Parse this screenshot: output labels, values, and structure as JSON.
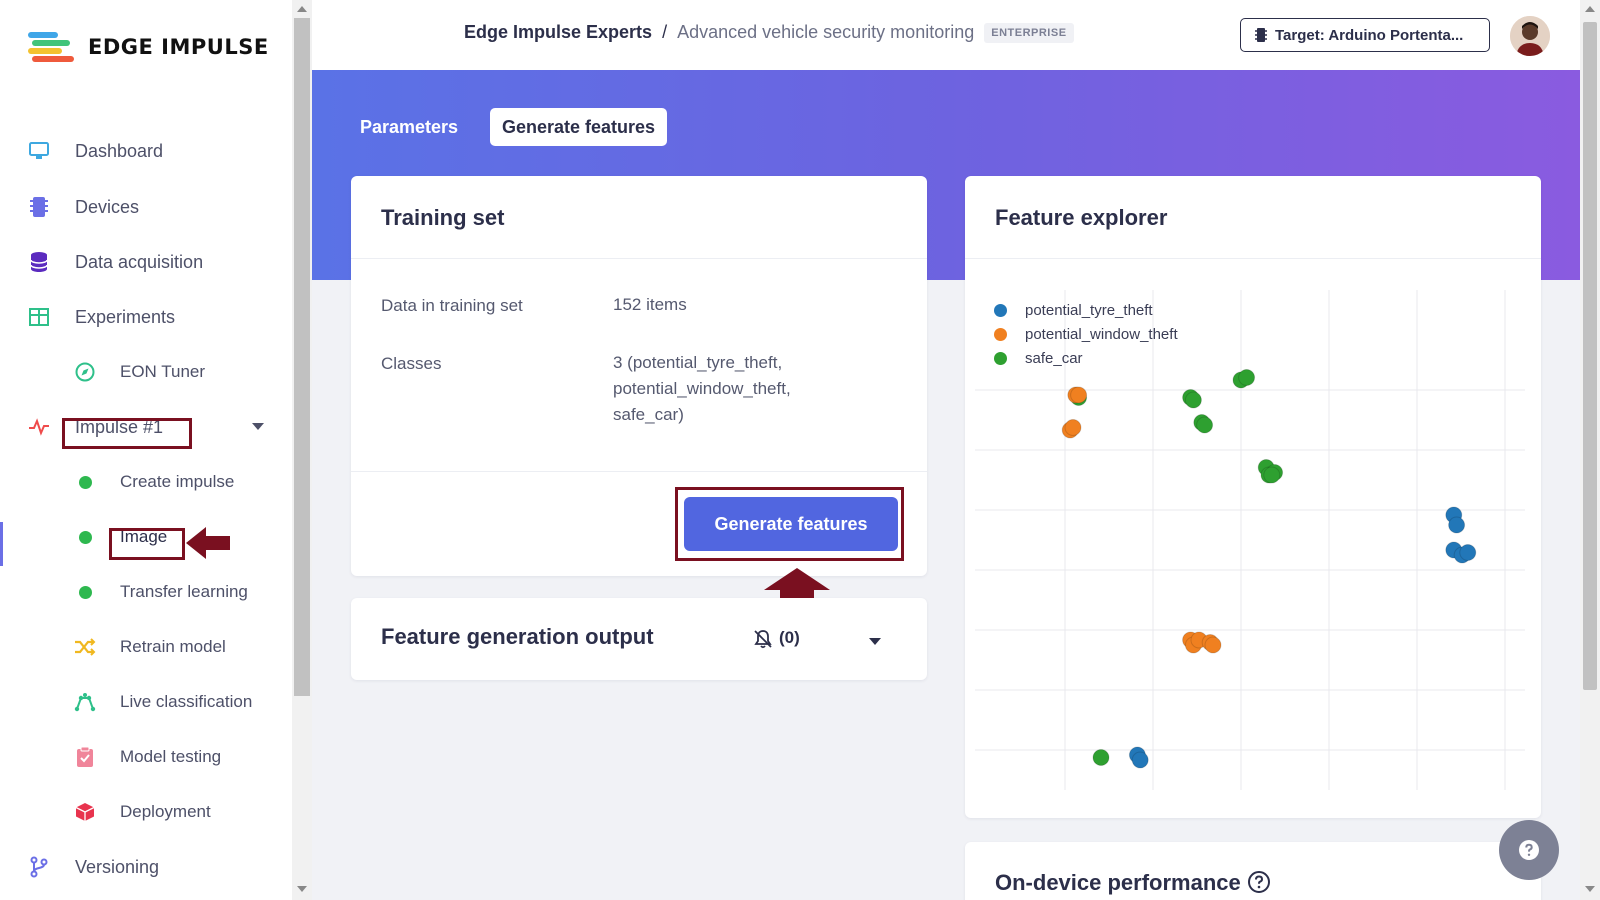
{
  "brand": {
    "name": "EDGE IMPULSE"
  },
  "sidebar": {
    "items": [
      {
        "label": "Dashboard",
        "icon": "monitor-icon"
      },
      {
        "label": "Devices",
        "icon": "chip-icon"
      },
      {
        "label": "Data acquisition",
        "icon": "database-icon"
      },
      {
        "label": "Experiments",
        "icon": "grid-icon"
      },
      {
        "label": "EON Tuner",
        "icon": "compass-icon"
      },
      {
        "label": "Impulse #1",
        "icon": "pulse-icon"
      },
      {
        "label": "Create impulse",
        "icon": "status-dot-icon"
      },
      {
        "label": "Image",
        "icon": "status-dot-icon"
      },
      {
        "label": "Transfer learning",
        "icon": "status-dot-icon"
      },
      {
        "label": "Retrain model",
        "icon": "shuffle-icon"
      },
      {
        "label": "Live classification",
        "icon": "network-icon"
      },
      {
        "label": "Model testing",
        "icon": "clipboard-check-icon"
      },
      {
        "label": "Deployment",
        "icon": "cube-icon"
      },
      {
        "label": "Versioning",
        "icon": "branch-icon"
      }
    ]
  },
  "header": {
    "project": "Edge Impulse Experts",
    "separator": "/",
    "project_name": "Advanced vehicle security monitoring",
    "badge": "ENTERPRISE",
    "target_label": "Target: Arduino Portenta..."
  },
  "tabs": [
    {
      "label": "Parameters"
    },
    {
      "label": "Generate features"
    }
  ],
  "training_set": {
    "title": "Training set",
    "rows": [
      {
        "label": "Data in training set",
        "value": "152 items"
      },
      {
        "label": "Classes",
        "value_lines": [
          "3 (potential_tyre_theft,",
          "potential_window_theft,",
          "safe_car)"
        ]
      }
    ],
    "button_label": "Generate features"
  },
  "output": {
    "title": "Feature generation output",
    "count": "(0)"
  },
  "feature_explorer": {
    "title": "Feature explorer"
  },
  "on_device": {
    "title": "On-device performance"
  },
  "colors": {
    "accent": "#5166e0",
    "highlight": "#7a1020",
    "class_blue": "#2277b8",
    "class_orange": "#f08020",
    "class_green": "#2ea030"
  },
  "chart_data": {
    "type": "scatter",
    "legend": "top-left",
    "grid": true,
    "series": [
      {
        "name": "potential_tyre_theft",
        "color": "#2277b8",
        "points": [
          [
            0.855,
            0.45
          ],
          [
            0.86,
            0.47
          ],
          [
            0.855,
            0.52
          ],
          [
            0.87,
            0.53
          ],
          [
            0.88,
            0.525
          ],
          [
            0.29,
            0.93
          ],
          [
            0.295,
            0.94
          ]
        ]
      },
      {
        "name": "potential_window_theft",
        "color": "#f08020",
        "points": [
          [
            0.18,
            0.21
          ],
          [
            0.185,
            0.21
          ],
          [
            0.17,
            0.28
          ],
          [
            0.175,
            0.275
          ],
          [
            0.385,
            0.7
          ],
          [
            0.39,
            0.71
          ],
          [
            0.4,
            0.7
          ],
          [
            0.42,
            0.705
          ],
          [
            0.425,
            0.71
          ]
        ]
      },
      {
        "name": "safe_car",
        "color": "#2ea030",
        "points": [
          [
            0.185,
            0.215
          ],
          [
            0.385,
            0.215
          ],
          [
            0.39,
            0.22
          ],
          [
            0.405,
            0.265
          ],
          [
            0.41,
            0.27
          ],
          [
            0.475,
            0.18
          ],
          [
            0.485,
            0.175
          ],
          [
            0.52,
            0.355
          ],
          [
            0.525,
            0.37
          ],
          [
            0.535,
            0.365
          ],
          [
            0.53,
            0.37
          ],
          [
            0.225,
            0.935
          ]
        ]
      }
    ]
  }
}
